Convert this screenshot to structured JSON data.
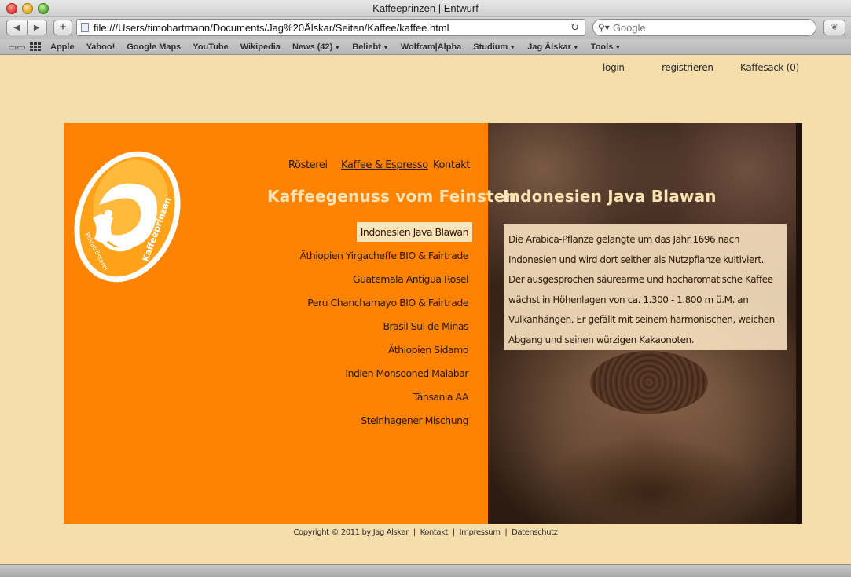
{
  "window": {
    "title": "Kaffeeprinzen | Entwurf"
  },
  "toolbar": {
    "url": "file:///Users/timohartmann/Documents/Jag%20Älskar/Seiten/Kaffee/kaffee.html",
    "search_placeholder": "Google"
  },
  "bookmarks": [
    {
      "label": "Apple",
      "menu": false
    },
    {
      "label": "Yahoo!",
      "menu": false
    },
    {
      "label": "Google Maps",
      "menu": false
    },
    {
      "label": "YouTube",
      "menu": false
    },
    {
      "label": "Wikipedia",
      "menu": false
    },
    {
      "label": "News (42)",
      "menu": true
    },
    {
      "label": "Beliebt",
      "menu": true
    },
    {
      "label": "Wolfram|Alpha",
      "menu": false
    },
    {
      "label": "Studium",
      "menu": true
    },
    {
      "label": "Jag Älskar",
      "menu": true
    },
    {
      "label": "Tools",
      "menu": true
    }
  ],
  "user_links": {
    "login": "login",
    "register": "registrieren",
    "cart": "Kaffesack (0)"
  },
  "logo": {
    "line1": "Kaffeeprinzen",
    "line2": "Privatrösterei"
  },
  "nav": {
    "roastery": "Rösterei",
    "coffee": "Kaffee & Espresso",
    "contact": "Kontakt"
  },
  "headline": "Kaffeegenuss vom Feinsten",
  "coffees": [
    "Indonesien Java Blawan",
    "Äthiopien Yirgacheffe BIO & Fairtrade",
    "Guatemala Antigua Rosel",
    "Peru Chanchamayo BIO & Fairtrade",
    "Brasil Sul de Minas",
    "Äthiopien Sidamo",
    "Indien Monsooned Malabar",
    "Tansania AA",
    "Steinhagener Mischung"
  ],
  "selected_coffee": "Indonesien Java Blawan",
  "detail": {
    "title": "Indonesien Java Blawan",
    "text": "Die Arabica-Pflanze gelangte um das Jahr 1696 nach Indonesien und wird dort seither als Nutzpflanze kultiviert. Der ausgesprochen säurearme und hocharomatische Kaffee wächst in Höhenlagen von ca. 1.300 - 1.800 m ü.M. an Vulkanhängen. Er gefällt mit seinem harmonischen, weichen Abgang und seinen würzigen Kakaonoten."
  },
  "footer": {
    "copyright": "Copyright © 2011 by Jag Älskar",
    "contact": "Kontakt",
    "imprint": "Impressum",
    "privacy": "Datenschutz"
  }
}
